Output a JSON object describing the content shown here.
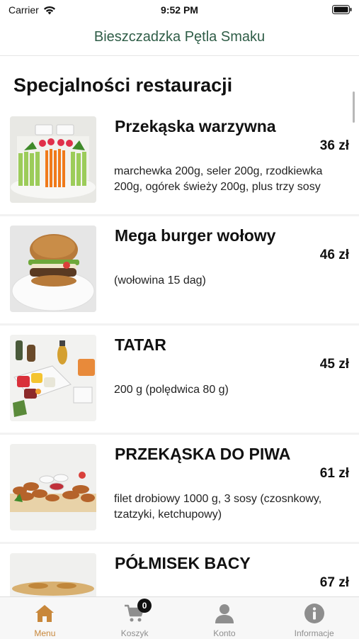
{
  "status_bar": {
    "carrier": "Carrier",
    "time": "9:52 PM"
  },
  "nav": {
    "title": "Bieszczadzka Pętla Smaku"
  },
  "section": {
    "title": "Specjalności restauracji"
  },
  "items": [
    {
      "name": "Przekąska warzywna",
      "price": "36 zł",
      "description": "marchewka 200g, seler 200g, rzodkiewka 200g, ogórek świeży 200g, plus trzy sosy",
      "image": "vegetable-platter"
    },
    {
      "name": "Mega burger wołowy",
      "price": "46 zł",
      "description": "(wołowina 15 dag)",
      "image": "burger"
    },
    {
      "name": "TATAR",
      "price": "45 zł",
      "description": "200 g (polędwica 80 g)",
      "image": "tartare"
    },
    {
      "name": "PRZEKĄSKA DO PIWA",
      "price": "61 zł",
      "description": "filet drobiowy 1000 g, 3 sosy (czosnkowy, tzatzyki, ketchupowy)",
      "image": "chicken-strips"
    },
    {
      "name": "PÓŁMISEK BACY",
      "price": "67 zł",
      "description": "",
      "image": "platter"
    }
  ],
  "tabs": [
    {
      "label": "Menu",
      "icon": "home-icon",
      "active": true
    },
    {
      "label": "Koszyk",
      "icon": "cart-icon",
      "badge": "0"
    },
    {
      "label": "Konto",
      "icon": "user-icon"
    },
    {
      "label": "Informacje",
      "icon": "info-icon"
    }
  ],
  "colors": {
    "nav_title": "#2f5d47",
    "active_tab": "#c8873a",
    "inactive_tab": "#8e8e8e"
  }
}
